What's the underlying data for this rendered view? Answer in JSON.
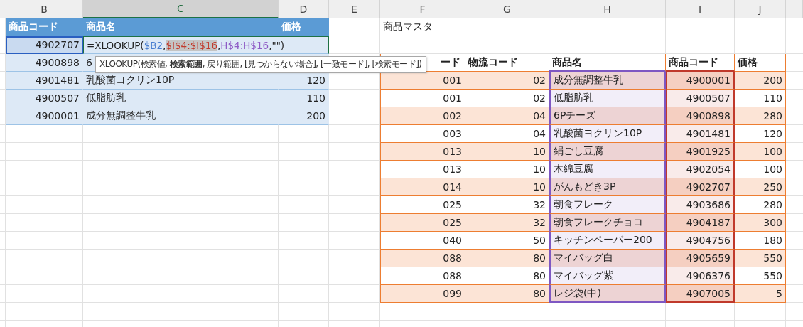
{
  "column_headers": [
    {
      "label": "B",
      "selected": false
    },
    {
      "label": "C",
      "selected": true
    },
    {
      "label": "D",
      "selected": false
    },
    {
      "label": "E",
      "selected": false
    },
    {
      "label": "F",
      "selected": false
    },
    {
      "label": "G",
      "selected": false
    },
    {
      "label": "H",
      "selected": false
    },
    {
      "label": "I",
      "selected": false
    },
    {
      "label": "J",
      "selected": false
    }
  ],
  "left_table": {
    "columns": [
      "商品コード",
      "商品名",
      "価格"
    ],
    "formula": {
      "parts": [
        {
          "text": "=XLOOKUP(",
          "selected": false
        },
        {
          "text": "$B2",
          "color": "#4a7fd0",
          "selected": false
        },
        {
          "text": ",",
          "selected": false
        },
        {
          "text": "$I$4:$I$16",
          "color": "#c0392b",
          "selected": true
        },
        {
          "text": ",",
          "selected": false
        },
        {
          "text": "H$4:H$16",
          "color": "#8e5cc6",
          "selected": false
        },
        {
          "text": ",\"\")",
          "selected": false
        }
      ]
    },
    "rows": [
      {
        "cells": [
          "4902707"
        ],
        "selected": true
      },
      {
        "cells": [
          "4900898",
          "6"
        ],
        "selected": false
      },
      {
        "cells": [
          "4901481",
          "乳酸菌ヨクリン10P",
          "120"
        ],
        "selected": false
      },
      {
        "cells": [
          "4900507",
          "低脂肪乳",
          "110"
        ],
        "selected": false
      },
      {
        "cells": [
          "4900001",
          "成分無調整牛乳",
          "200"
        ],
        "selected": false
      }
    ]
  },
  "tooltip": "XLOOKUP(検索値, **検索範囲**, 戻り範囲, [見つからない場合], [一致モード], [検索モード])",
  "right_table": {
    "title": "商品マスタ",
    "columns": [
      {
        "label": "ード",
        "kind": "number"
      },
      {
        "label": "物流コード",
        "kind": "number"
      },
      {
        "label": "商品名",
        "kind": "text",
        "color": "#7e57c2"
      },
      {
        "label": "商品コード",
        "kind": "number",
        "color": "#c0392b"
      },
      {
        "label": "価格",
        "kind": "number"
      }
    ],
    "rows": [
      [
        "001",
        "02",
        "成分無調整牛乳",
        "4900001",
        "200"
      ],
      [
        "001",
        "02",
        "低脂肪乳",
        "4900507",
        "110"
      ],
      [
        "002",
        "04",
        "6Pチーズ",
        "4900898",
        "280"
      ],
      [
        "003",
        "04",
        "乳酸菌ヨクリン10P",
        "4901481",
        "120"
      ],
      [
        "013",
        "10",
        "絹ごし豆腐",
        "4901925",
        "100"
      ],
      [
        "013",
        "10",
        "木綿豆腐",
        "4902054",
        "100"
      ],
      [
        "014",
        "10",
        "がんもどき3P",
        "4902707",
        "250"
      ],
      [
        "025",
        "32",
        "朝食フレーク",
        "4903686",
        "280"
      ],
      [
        "025",
        "32",
        "朝食フレークチョコ",
        "4904187",
        "300"
      ],
      [
        "040",
        "50",
        "キッチンペーパー200",
        "4904756",
        "180"
      ],
      [
        "088",
        "80",
        "マイバッグ白",
        "4905659",
        "550"
      ],
      [
        "088",
        "80",
        "マイバッグ紫",
        "4906376",
        "550"
      ],
      [
        "099",
        "80",
        "レジ袋(中)",
        "4907005",
        "5"
      ]
    ]
  }
}
